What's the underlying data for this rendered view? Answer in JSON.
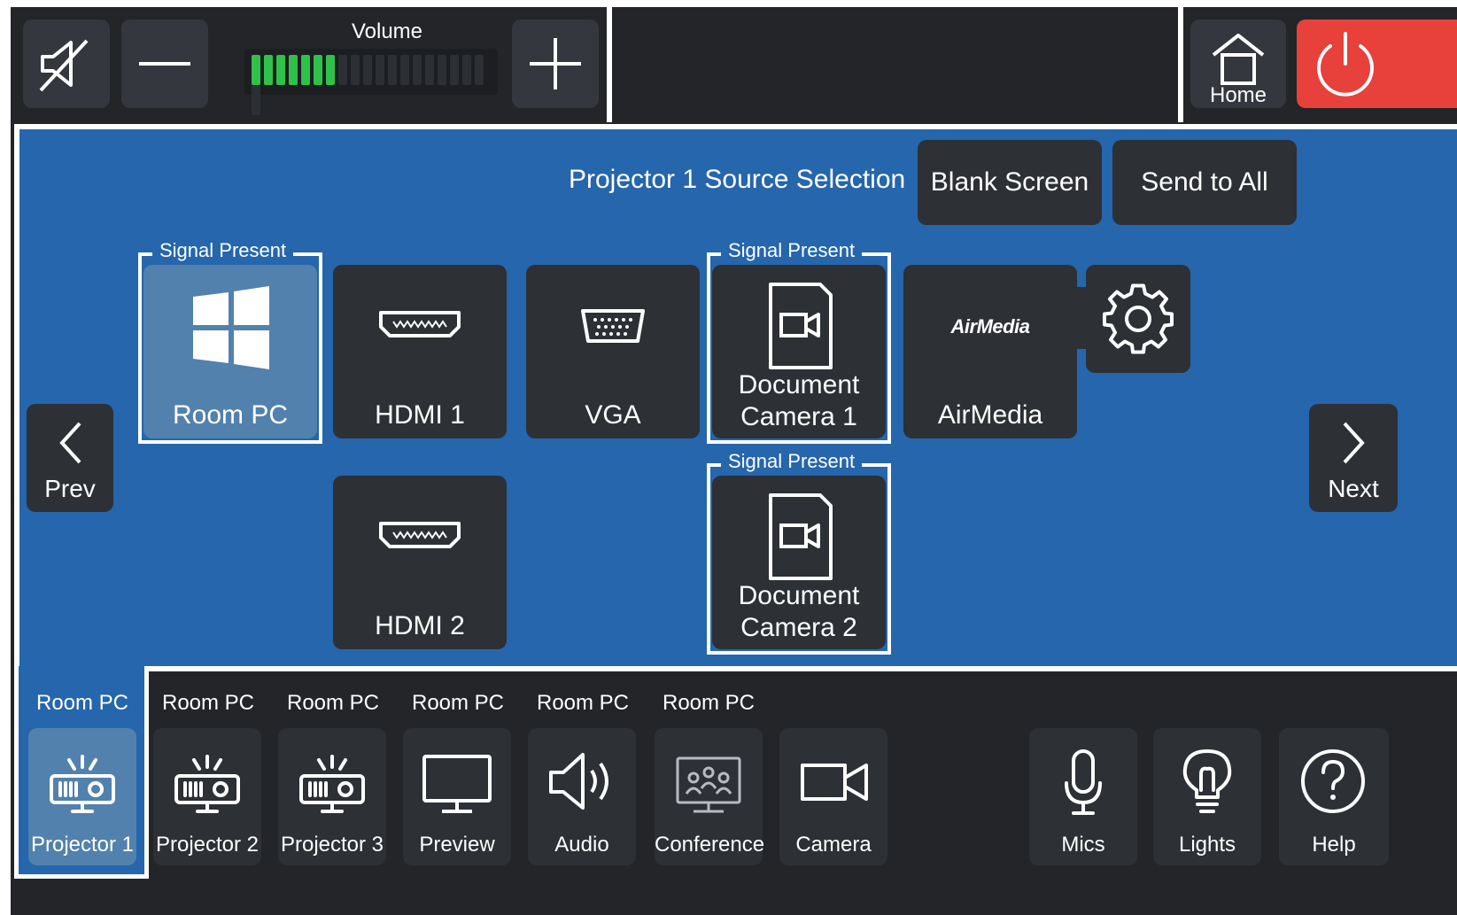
{
  "topbar": {
    "mute_icon": "speaker-mute-icon",
    "volume_label": "Volume",
    "volume_level": 0.35,
    "volume_segments": 20,
    "home_label": "Home"
  },
  "main": {
    "title": "Projector 1 Source Selection",
    "blank_screen": "Blank Screen",
    "send_to_all": "Send to All",
    "prev": "Prev",
    "next": "Next",
    "signal_present": "Signal Present",
    "sources": {
      "room_pc": "Room PC",
      "hdmi1": "HDMI 1",
      "vga": "VGA",
      "doc_cam1_line1": "Document",
      "doc_cam1_line2": "Camera 1",
      "airmedia": "AirMedia",
      "airmedia_logo": "AirMedia",
      "hdmi2": "HDMI 2",
      "doc_cam2_line1": "Document",
      "doc_cam2_line2": "Camera 2"
    }
  },
  "bottom": {
    "captions": [
      "Room PC",
      "Room PC",
      "Room PC",
      "Room PC",
      "Room PC",
      "Room PC"
    ],
    "buttons": {
      "projector1": "Projector 1",
      "projector2": "Projector 2",
      "projector3": "Projector 3",
      "preview": "Preview",
      "audio": "Audio",
      "conference": "Conference",
      "camera": "Camera",
      "mics": "Mics",
      "lights": "Lights",
      "help": "Help"
    }
  },
  "colors": {
    "accent_blue": "#2566ac",
    "selected_tile": "#5281ae",
    "power_red": "#e8403b",
    "volume_green": "#2ec24a"
  }
}
